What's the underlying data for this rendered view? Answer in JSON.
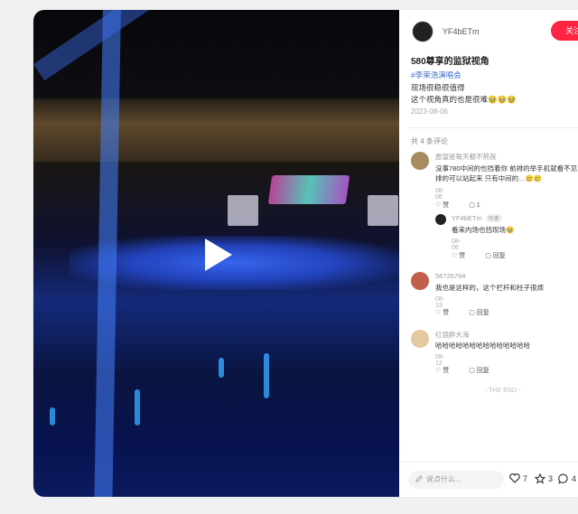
{
  "video": {
    "play_icon": "play-icon"
  },
  "author": {
    "name": "YF4bETm",
    "follow_label": "关注"
  },
  "post": {
    "title": "580尊享的监狱视角",
    "tag": "#李荣浩演唱会",
    "lines": [
      "现场很稳很值得",
      "这个视角真的也是很难🥹🥹🥹"
    ],
    "date": "2023-08-06"
  },
  "comments_header": "共 4 条评论",
  "comments": [
    {
      "name": "愿望是每天都不熬夜",
      "lines": [
        "没事780中间的也挡着你 前排的举手机就看不见了",
        "排的可以站起来 只有中间的…🥲🥲"
      ],
      "date": "08-06",
      "like": "赞",
      "reply": "1"
    },
    {
      "name": "YF4bETm",
      "badge": "作者",
      "lines": [
        "看来内场也挡现场🥹"
      ],
      "date": "08-06",
      "like": "赞",
      "reply": "回复"
    },
    {
      "name": "56725794",
      "lines": [
        "我也是这样的，这个栏杆和柱子很烦"
      ],
      "date": "08-13",
      "like": "赞",
      "reply": "回复"
    },
    {
      "name": "红烧胖大海",
      "lines": [
        "哈哈哈哈哈哈哈哈哈哈哈哈哈哈"
      ],
      "date": "08-12",
      "like": "赞",
      "reply": "回复"
    }
  ],
  "the_end": "- THE END -",
  "bottom": {
    "input_placeholder": "说点什么...",
    "likes": "7",
    "stars": "3",
    "comments": "4"
  }
}
